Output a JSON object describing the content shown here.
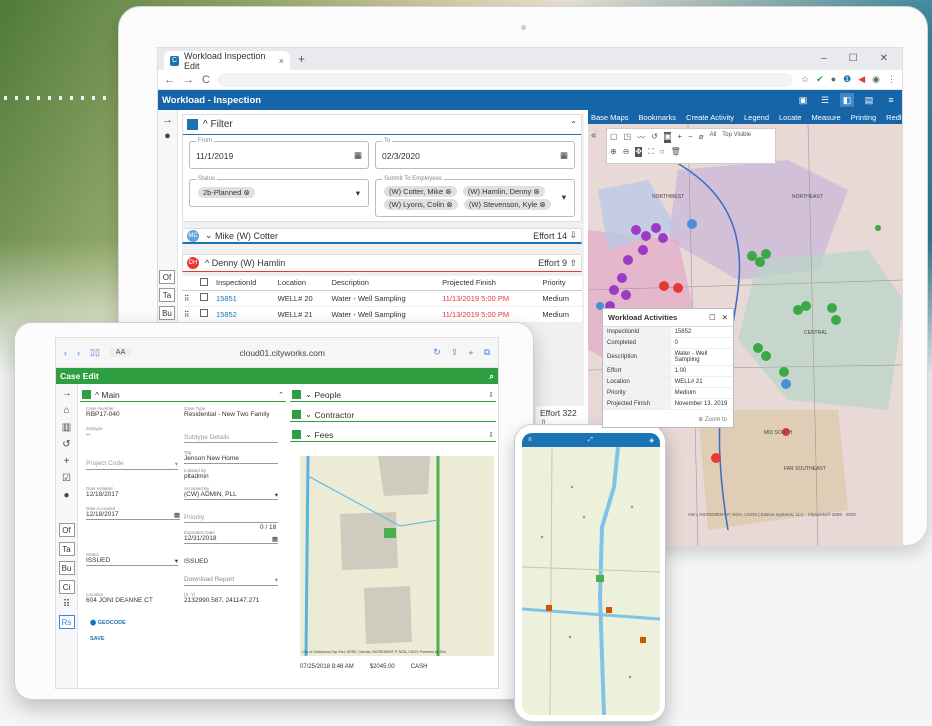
{
  "browser": {
    "tab_title": "Workload Inspection Edit",
    "new_tab": "+",
    "close_tab": "×",
    "window_controls": [
      "–",
      "☐",
      "✕"
    ]
  },
  "app": {
    "title": "Workload - Inspection",
    "filter": {
      "title": "Filter",
      "from_caption": "From",
      "from_value": "11/1/2019",
      "to_caption": "To",
      "to_value": "02/3/2020",
      "status_caption": "Status",
      "status_value": "2b-Planned",
      "submit_caption": "Submit To Employees",
      "employees": [
        "(W) Cotter, Mike",
        "(W) Hamlin, Denny",
        "(W) Lyons, Colin",
        "(W) Stevenson, Kyle"
      ]
    },
    "groups": [
      {
        "badge": "MC",
        "name": "Mike (W) Cotter",
        "effort": "Effort 14"
      },
      {
        "badge": "DH",
        "name": "Denny (W) Hamlin",
        "effort": "Effort 9"
      }
    ],
    "table": {
      "headers": [
        "InspectionId",
        "Location",
        "Description",
        "Projected Finish",
        "Priority"
      ],
      "rows": [
        {
          "id": "15851",
          "location": "WELL# 20",
          "description": "Water - Well Sampling",
          "finish": "11/13/2019 5:00 PM",
          "priority": "Medium"
        },
        {
          "id": "15852",
          "location": "WELL# 21",
          "description": "Water - Well Sampling",
          "finish": "11/13/2019 5:00 PM",
          "priority": "Medium"
        }
      ]
    },
    "effort_322": "Effort 322",
    "side_chips": [
      "Of",
      "Ta",
      "Bu"
    ],
    "map": {
      "nav": [
        "Base Maps",
        "Bookmarks",
        "Create Activity",
        "Legend",
        "Locate",
        "Measure",
        "Printing",
        "Redline"
      ],
      "tools_all": "All",
      "tools_top_visible": "Top Visible",
      "regions": [
        "NORTHWEST",
        "NORTHEAST",
        "CENTRAL",
        "MID SOUTH",
        "FAR SOUTHEAST"
      ],
      "attribution": "rmin, INCREMENT P, NGA, USGS | Esteca Systems, LLC · Cityworks® 2009 - 2020",
      "popup": {
        "title": "Workload Activities",
        "rows": [
          {
            "k": "InspectionId",
            "v": "15852"
          },
          {
            "k": "Completed",
            "v": "0"
          },
          {
            "k": "Description",
            "v": "Water - Well Sampling"
          },
          {
            "k": "Effort",
            "v": "1.00"
          },
          {
            "k": "Location",
            "v": "WELL# 21"
          },
          {
            "k": "Priority",
            "v": "Medium"
          },
          {
            "k": "Projected Finish",
            "v": "November 13, 2019"
          }
        ],
        "zoom_to": "Zoom to"
      }
    }
  },
  "tablet": {
    "url": "cloud01.cityworks.com",
    "aa": "AA",
    "title": "Case Edit",
    "main": {
      "title": "Main",
      "case_number_caption": "Case Number",
      "case_number": "RBP17-040",
      "case_type_caption": "Case Type",
      "case_type": "Residential - New Two Family",
      "subtype_caption": "Subtype",
      "subtype": "--",
      "subtype_details": "Subtype Details",
      "project_code": "Project Code",
      "tag_caption": "Tag",
      "tag": "Jenson New Home",
      "initiated_by_caption": "Initiated By",
      "initiated_by": "pltadmin",
      "date_initiated_caption": "Date Initiated",
      "date_initiated": "12/18/2017",
      "accepted_by_caption": "Accepted By",
      "accepted_by": "(CW) ADMIN, PLL",
      "date_accepted_caption": "Date Accepted",
      "date_accepted": "12/18/2017",
      "priority": "Priority",
      "counter": "0 / 18",
      "expiration_caption": "Expiration Date",
      "expiration": "12/31/2018",
      "status_caption": "Status",
      "status": "ISSUED",
      "status_right": "ISSUED",
      "download_report": "Download Report",
      "location_caption": "Location",
      "location": "604 JONI DEANNE CT",
      "xy_caption": "(X, Y)",
      "xy": "2132990.587, 241147.271",
      "geocode": "GEOCODE",
      "save": "SAVE"
    },
    "people": "People",
    "contractor": "Contractor",
    "fees": "Fees",
    "fee_row": {
      "date": "07/25/2018 8:48 AM",
      "amount": "$2045.00",
      "type": "CASH"
    },
    "side_chips": [
      "Of",
      "Ta",
      "Bu",
      "Ci",
      "Rs"
    ],
    "map_attribution": "City of Oklahoma City, Esri, HERE, Garmin, INCREMENT P, NGA, USGS    Powered by Esri"
  },
  "phone": {}
}
